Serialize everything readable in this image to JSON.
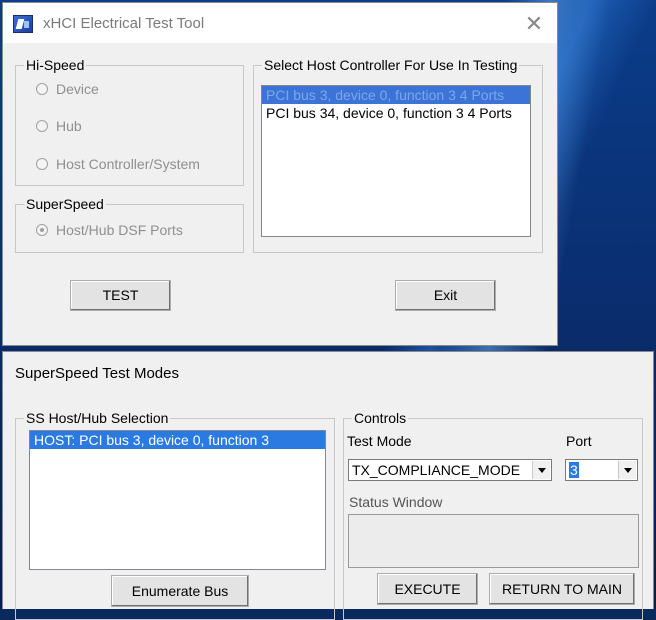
{
  "xhci_window": {
    "title": "xHCI Electrical Test Tool",
    "close_glyph": "✕",
    "hispeed": {
      "legend": "Hi-Speed",
      "options": [
        "Device",
        "Hub",
        "Host Controller/System"
      ]
    },
    "superspeed": {
      "legend": "SuperSpeed",
      "option": "Host/Hub DSF Ports",
      "option_checked": true
    },
    "host_select": {
      "legend": "Select Host Controller For Use In Testing",
      "items": [
        "PCI bus 3, device 0, function 3  4 Ports",
        "PCI bus 34, device 0, function 3  4 Ports"
      ],
      "selected_index": 0
    },
    "test_button": "TEST",
    "exit_button": "Exit"
  },
  "ss_window": {
    "title": "SuperSpeed Test Modes",
    "selection": {
      "legend": "SS Host/Hub Selection",
      "items": [
        "HOST: PCI bus 3, device 0, function 3"
      ],
      "selected_index": 0
    },
    "enumerate_button": "Enumerate Bus",
    "controls": {
      "legend": "Controls",
      "test_mode_label": "Test Mode",
      "test_mode_value": "TX_COMPLIANCE_MODE",
      "port_label": "Port",
      "port_value": "3",
      "status_label": "Status Window",
      "status_text": ""
    },
    "execute_button": "EXECUTE",
    "return_button": "RETURN TO MAIN"
  }
}
